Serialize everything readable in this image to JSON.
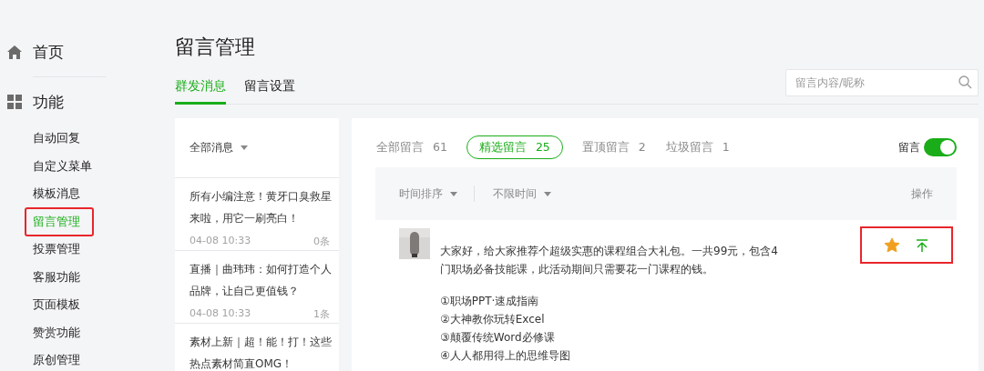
{
  "sidebar": {
    "home": {
      "label": "首页"
    },
    "section": {
      "label": "功能"
    },
    "items": [
      {
        "label": "自动回复",
        "selected": false,
        "highlighted": false
      },
      {
        "label": "自定义菜单",
        "selected": false,
        "highlighted": false
      },
      {
        "label": "模板消息",
        "selected": false,
        "highlighted": false
      },
      {
        "label": "留言管理",
        "selected": true,
        "highlighted": true
      },
      {
        "label": "投票管理",
        "selected": false,
        "highlighted": false
      },
      {
        "label": "客服功能",
        "selected": false,
        "highlighted": false
      },
      {
        "label": "页面模板",
        "selected": false,
        "highlighted": false
      },
      {
        "label": "赞赏功能",
        "selected": false,
        "highlighted": false
      },
      {
        "label": "原创管理",
        "selected": false,
        "highlighted": false
      }
    ]
  },
  "header": {
    "title": "留言管理",
    "tabs": [
      {
        "label": "群发消息",
        "selected": true
      },
      {
        "label": "留言设置",
        "selected": false
      }
    ],
    "search": {
      "placeholder": "留言内容/昵称"
    }
  },
  "message_list": {
    "filter": "全部消息",
    "items": [
      {
        "title": "所有小编注意！黄牙口臭救星来啦，用它一刷亮白！",
        "date": "04-08 10:33",
        "count": "0条"
      },
      {
        "title": "直播｜曲玮玮：如何打造个人品牌，让自己更值钱？",
        "date": "04-08 10:33",
        "count": "1条"
      },
      {
        "title": "素材上新｜超！能！打！这些热点素材简直OMG！"
      }
    ]
  },
  "comments": {
    "filters": [
      {
        "label": "全部留言",
        "count": "61",
        "selected": false
      },
      {
        "label": "精选留言",
        "count": "25",
        "selected": true
      },
      {
        "label": "置顶留言",
        "count": "2",
        "selected": false
      },
      {
        "label": "垃圾留言",
        "count": "1",
        "selected": false
      }
    ],
    "toggle": {
      "label": "留言",
      "on": true
    },
    "columns": {
      "sort": "时间排序",
      "range": "不限时间",
      "actions": "操作"
    },
    "rows": [
      {
        "text": "大家好，给大家推荐个超级实惠的课程组合大礼包。一共99元，包含4门职场必备技能课，此活动期间只需要花一门课程的钱。",
        "list": [
          "①职场PPT·速成指南",
          "②大神教你玩转Excel",
          "③颠覆传统Word必修课",
          "④人人都用得上的思维导图"
        ],
        "starred": true,
        "highlighted": true
      }
    ]
  }
}
